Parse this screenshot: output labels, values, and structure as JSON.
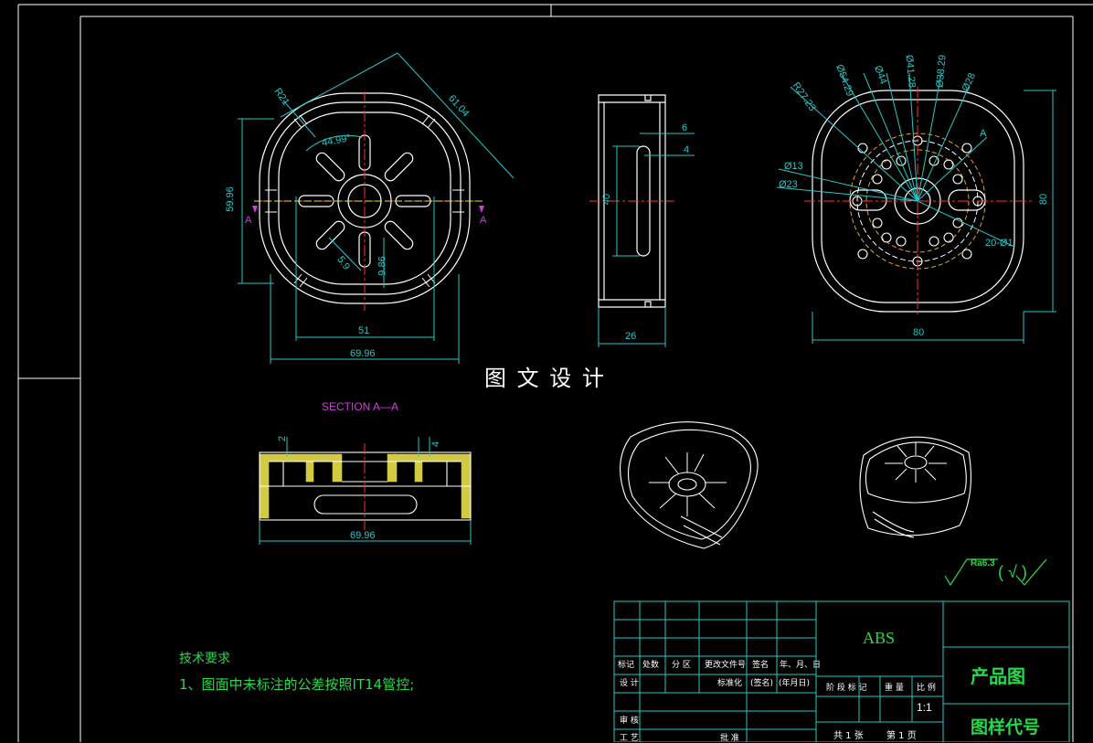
{
  "watermark": "图 文 设 计",
  "section_label": "SECTION  A—A",
  "section_markers": [
    "A",
    "A"
  ],
  "dimensions": {
    "front": {
      "r21": "R21",
      "d61": "61.04",
      "a44": "44.99°",
      "h5996": "59.96",
      "w51": "51",
      "w6996": "69.96",
      "d59": "5.9",
      "d98": "9.86"
    },
    "side": {
      "d6": "6",
      "d4": "4",
      "h40": "40",
      "w26": "26"
    },
    "top": {
      "r2723": "R27.23",
      "p5429": "Ø54.29",
      "p44": "Ø44",
      "p4128": "Ø41.28",
      "p3829": "Ø38.29",
      "p28": "Ø28",
      "p13": "Ø13",
      "p23": "Ø23",
      "holes": "20-Ø1",
      "h80": "80",
      "w80": "80",
      "a": "A"
    },
    "section": {
      "d2": "2",
      "d4": "4",
      "w6996": "69.96"
    }
  },
  "roughness": {
    "value": "Ra6.3",
    "bracket": "(  √  )"
  },
  "tech_requirements": {
    "title": "技术要求",
    "item1": "1、图面中未标注的公差按照IT14管控;"
  },
  "title_block": {
    "material": "ABS",
    "name": "产品图",
    "code": "图样代号",
    "scale": "1:1",
    "headers": [
      "标记",
      "处数",
      "分 区",
      "更改文件号",
      "签名",
      "年、月、日"
    ],
    "row2": [
      "设 计",
      "标准化",
      "(签名)",
      "(年月日)"
    ],
    "stage_headers": [
      "阶 段 标 记",
      "重 量",
      "比 例"
    ],
    "review": "审 核",
    "craft": "工 艺",
    "approve": "批 准",
    "sheet_info": [
      "共 1 张",
      "第 1 页"
    ]
  },
  "colors": {
    "background": "#000000",
    "outline": "#ffffff",
    "dimension": "#27c6c6",
    "text_green": "#27d94a",
    "center_line": "#ff3030",
    "section_label": "#d63adf",
    "hatch": "#e8e04a",
    "pitch_circle": "#e6a23c"
  }
}
